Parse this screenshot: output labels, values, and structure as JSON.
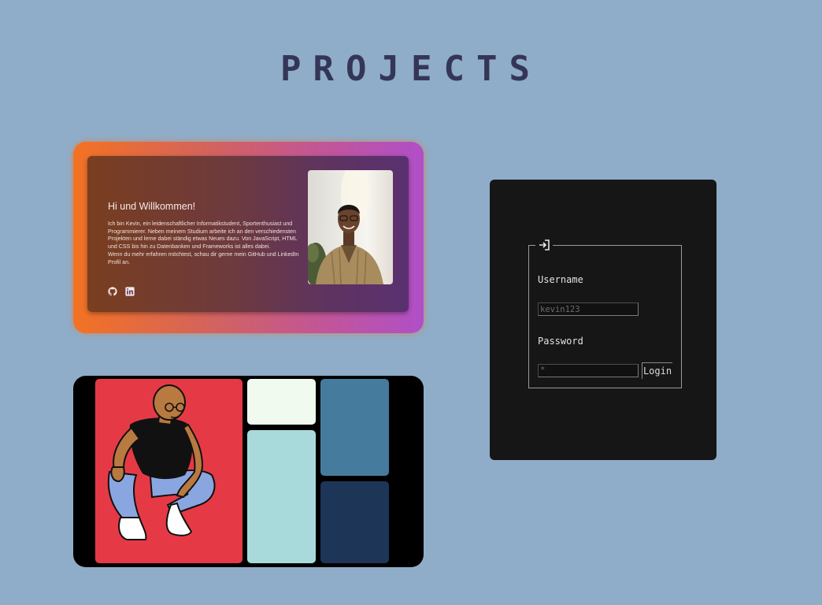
{
  "page": {
    "title": "PROJECTS"
  },
  "project_card_1": {
    "greeting": "Hi und Willkommen!",
    "bio_paragraph_1": "Ich bin Kevin, ein leidenschaftlicher Informatikstudent, Sportenthusiast und Programmierer. Neben meinem Studium arbeite ich an den verschiedensten Projekten und lerne dabei ständig etwas Neues dazu. Von JavaScript, HTML und CSS bis hin zu Datenbanken und Frameworks ist alles dabei.",
    "bio_paragraph_2": "Wenn du mehr erfahren möchtest, schau dir gerne mein GitHub und LinkedIn Profil an.",
    "icons": [
      "github-icon",
      "linkedin-icon"
    ],
    "gradient_colors": [
      "#f37223",
      "#b04fc8"
    ]
  },
  "project_card_2": {
    "illustration": "person-crouching-illustration",
    "tile_colors": [
      "#e63946",
      "#f1faee",
      "#a8dadc",
      "#457b9d",
      "#1d3557"
    ]
  },
  "login_form": {
    "legend_icon": "login-icon",
    "username_label": "Username",
    "username_placeholder": "kevin123",
    "password_label": "Password",
    "password_value": "*",
    "login_button": "Login"
  },
  "colors": {
    "background": "#8fadc8",
    "title": "#353657",
    "login_panel": "#161616"
  }
}
